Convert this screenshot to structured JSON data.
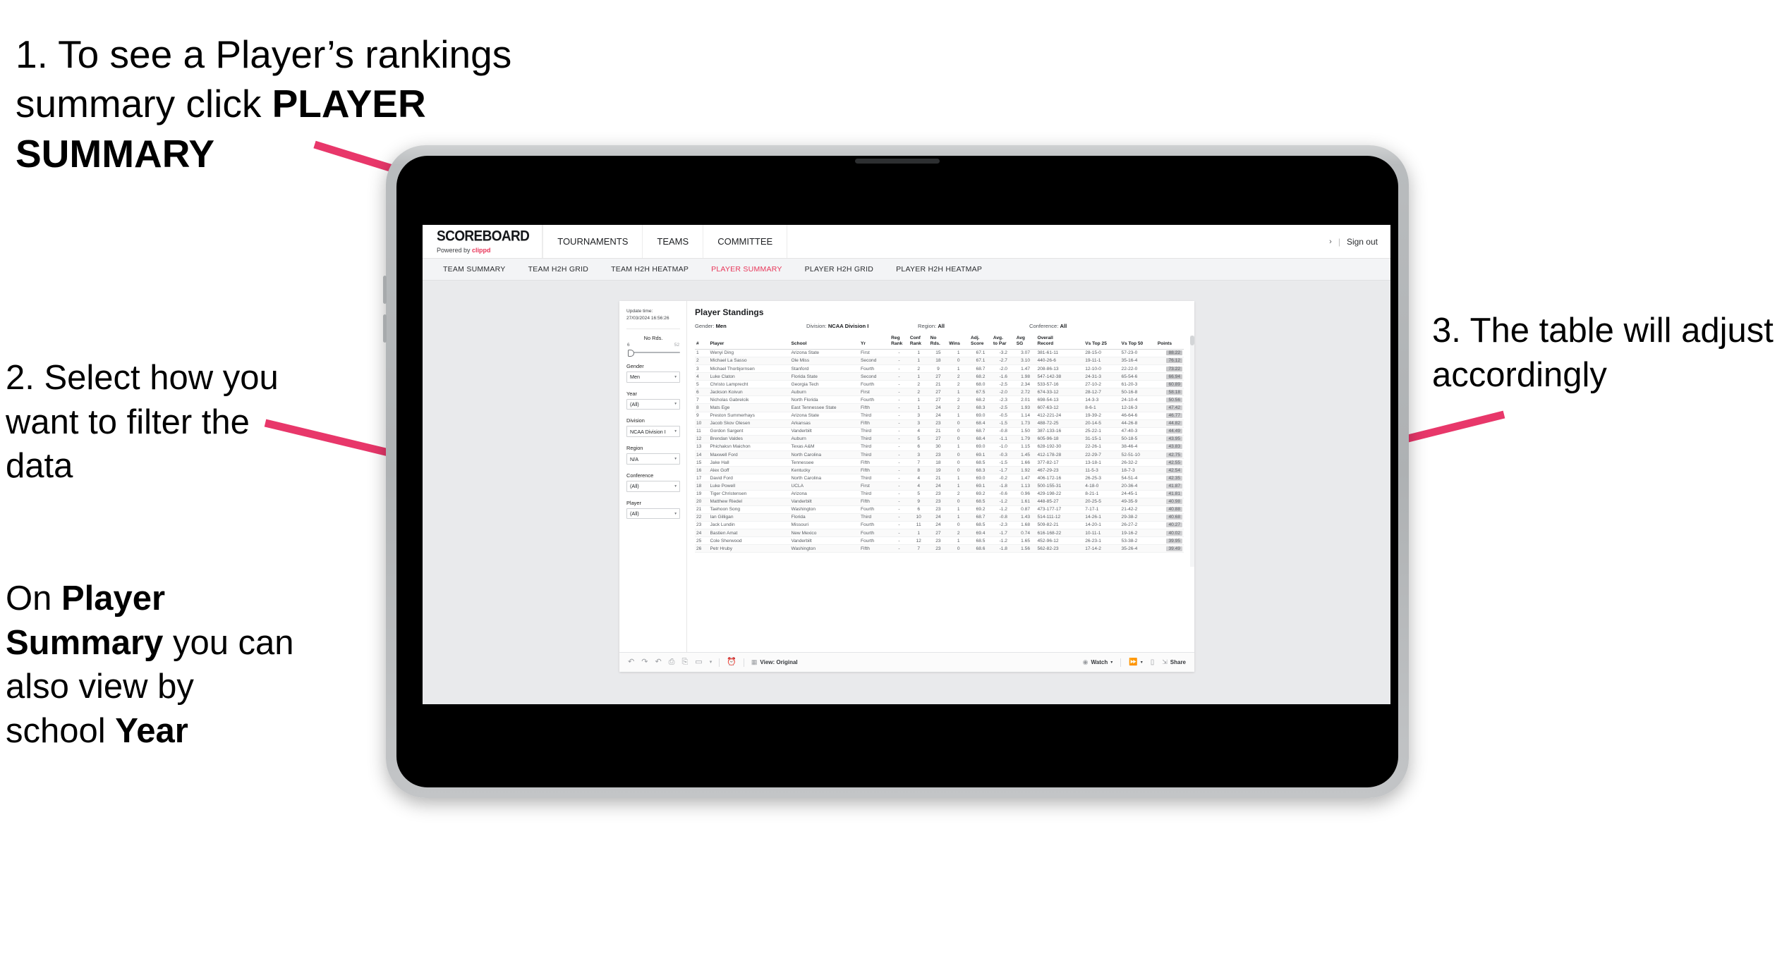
{
  "annotations": {
    "step1": {
      "number": "1.",
      "text_plain_a": "To see a Player’s rankings summary click ",
      "text_bold": "PLAYER SUMMARY"
    },
    "step2": {
      "text": "2. Select how you want to filter the data"
    },
    "step2b": {
      "prefix": "On ",
      "bold1": "Player Summary",
      "mid": " you can also view by school ",
      "bold2": "Year"
    },
    "step3": {
      "text": "3. The table will adjust accordingly"
    },
    "arrow_color": "#e8376a"
  },
  "header": {
    "brand_title": "SCOREBOARD",
    "brand_sub_prefix": "Powered by ",
    "brand_sub_name": "clippd",
    "nav": [
      {
        "label": "TOURNAMENTS"
      },
      {
        "label": "TEAMS"
      },
      {
        "label": "COMMITTEE"
      }
    ],
    "chevron": "›",
    "separator": "|",
    "sign_out": "Sign out"
  },
  "subnav": {
    "items": [
      {
        "label": "TEAM SUMMARY",
        "active": false
      },
      {
        "label": "TEAM H2H GRID",
        "active": false
      },
      {
        "label": "TEAM H2H HEATMAP",
        "active": false
      },
      {
        "label": "PLAYER SUMMARY",
        "active": true
      },
      {
        "label": "PLAYER H2H GRID",
        "active": false
      },
      {
        "label": "PLAYER H2H HEATMAP",
        "active": false
      }
    ],
    "active_color": "#e8375a"
  },
  "filters": {
    "update_label": "Update time:",
    "update_value": "27/03/2024 16:56:26",
    "slider": {
      "title": "No Rds.",
      "min": "6",
      "max": "52"
    },
    "selects": [
      {
        "label": "Gender",
        "value": "Men"
      },
      {
        "label": "Year",
        "value": "(All)"
      },
      {
        "label": "Division",
        "value": "NCAA Division I"
      },
      {
        "label": "Region",
        "value": "N/A"
      },
      {
        "label": "Conference",
        "value": "(All)"
      },
      {
        "label": "Player",
        "value": "(All)"
      }
    ],
    "caret": "▾"
  },
  "viz": {
    "title": "Player Standings",
    "filter_summary": [
      {
        "key": "Gender:",
        "value": "Men"
      },
      {
        "key": "Division:",
        "value": "NCAA Division I"
      },
      {
        "key": "Region:",
        "value": "All"
      },
      {
        "key": "Conference:",
        "value": "All"
      }
    ],
    "columns": [
      {
        "l1": "#",
        "l2": ""
      },
      {
        "l1": "Player",
        "l2": ""
      },
      {
        "l1": "School",
        "l2": ""
      },
      {
        "l1": "Yr",
        "l2": ""
      },
      {
        "l1": "Reg",
        "l2": "Rank"
      },
      {
        "l1": "Conf",
        "l2": "Rank"
      },
      {
        "l1": "No",
        "l2": "Rds."
      },
      {
        "l1": "Wins",
        "l2": ""
      },
      {
        "l1": "Adj.",
        "l2": "Score"
      },
      {
        "l1": "Avg.",
        "l2": "to Par"
      },
      {
        "l1": "Avg",
        "l2": "SG"
      },
      {
        "l1": "Overall",
        "l2": "Record"
      },
      {
        "l1": "Vs Top 25",
        "l2": ""
      },
      {
        "l1": "Vs Top 50",
        "l2": ""
      },
      {
        "l1": "Points",
        "l2": ""
      }
    ],
    "rows": [
      {
        "n": "1",
        "player": "Wenyi Ding",
        "school": "Arizona State",
        "yr": "First",
        "reg": "-",
        "conf": "1",
        "rds": "15",
        "wins": "1",
        "adj": "67.1",
        "par": "-3.2",
        "sg": "3.07",
        "rec": "381-61-11",
        "t25": "28-15-0",
        "t50": "57-23-0",
        "pts": "88.22"
      },
      {
        "n": "2",
        "player": "Michael La Sasso",
        "school": "Ole Miss",
        "yr": "Second",
        "reg": "-",
        "conf": "1",
        "rds": "18",
        "wins": "0",
        "adj": "67.1",
        "par": "-2.7",
        "sg": "3.10",
        "rec": "440-26-6",
        "t25": "19-11-1",
        "t50": "35-16-4",
        "pts": "76.12"
      },
      {
        "n": "3",
        "player": "Michael Thorbjornsen",
        "school": "Stanford",
        "yr": "Fourth",
        "reg": "-",
        "conf": "2",
        "rds": "9",
        "wins": "1",
        "adj": "68.7",
        "par": "-2.0",
        "sg": "1.47",
        "rec": "208-86-13",
        "t25": "12-10-0",
        "t50": "22-22-0",
        "pts": "73.22"
      },
      {
        "n": "4",
        "player": "Luke Claton",
        "school": "Florida State",
        "yr": "Second",
        "reg": "-",
        "conf": "1",
        "rds": "27",
        "wins": "2",
        "adj": "68.2",
        "par": "-1.6",
        "sg": "1.98",
        "rec": "547-142-38",
        "t25": "24-31-3",
        "t50": "65-54-6",
        "pts": "66.94"
      },
      {
        "n": "5",
        "player": "Christo Lamprecht",
        "school": "Georgia Tech",
        "yr": "Fourth",
        "reg": "-",
        "conf": "2",
        "rds": "21",
        "wins": "2",
        "adj": "68.0",
        "par": "-2.5",
        "sg": "2.34",
        "rec": "533-57-16",
        "t25": "27-10-2",
        "t50": "61-20-3",
        "pts": "60.89"
      },
      {
        "n": "6",
        "player": "Jackson Koivun",
        "school": "Auburn",
        "yr": "First",
        "reg": "-",
        "conf": "2",
        "rds": "27",
        "wins": "1",
        "adj": "67.5",
        "par": "-2.0",
        "sg": "2.72",
        "rec": "674-33-12",
        "t25": "28-12-7",
        "t50": "50-16-8",
        "pts": "58.18"
      },
      {
        "n": "7",
        "player": "Nicholas Gabrelcik",
        "school": "North Florida",
        "yr": "Fourth",
        "reg": "-",
        "conf": "1",
        "rds": "27",
        "wins": "2",
        "adj": "68.2",
        "par": "-2.3",
        "sg": "2.01",
        "rec": "698-54-13",
        "t25": "14-3-3",
        "t50": "24-10-4",
        "pts": "50.56"
      },
      {
        "n": "8",
        "player": "Mats Ege",
        "school": "East Tennessee State",
        "yr": "Fifth",
        "reg": "-",
        "conf": "1",
        "rds": "24",
        "wins": "2",
        "adj": "68.3",
        "par": "-2.5",
        "sg": "1.93",
        "rec": "607-63-12",
        "t25": "8-6-1",
        "t50": "12-16-3",
        "pts": "47.42"
      },
      {
        "n": "9",
        "player": "Preston Summerhays",
        "school": "Arizona State",
        "yr": "Third",
        "reg": "-",
        "conf": "3",
        "rds": "24",
        "wins": "1",
        "adj": "69.0",
        "par": "-0.5",
        "sg": "1.14",
        "rec": "412-221-24",
        "t25": "19-39-2",
        "t50": "46-64-6",
        "pts": "46.77"
      },
      {
        "n": "10",
        "player": "Jacob Skov Olesen",
        "school": "Arkansas",
        "yr": "Fifth",
        "reg": "-",
        "conf": "3",
        "rds": "23",
        "wins": "0",
        "adj": "68.4",
        "par": "-1.5",
        "sg": "1.73",
        "rec": "488-72-25",
        "t25": "20-14-5",
        "t50": "44-26-8",
        "pts": "44.82"
      },
      {
        "n": "11",
        "player": "Gordon Sargent",
        "school": "Vanderbilt",
        "yr": "Third",
        "reg": "-",
        "conf": "4",
        "rds": "21",
        "wins": "0",
        "adj": "68.7",
        "par": "-0.8",
        "sg": "1.50",
        "rec": "387-133-16",
        "t25": "25-22-1",
        "t50": "47-40-3",
        "pts": "44.49"
      },
      {
        "n": "12",
        "player": "Brendan Valdes",
        "school": "Auburn",
        "yr": "Third",
        "reg": "-",
        "conf": "5",
        "rds": "27",
        "wins": "0",
        "adj": "68.4",
        "par": "-1.1",
        "sg": "1.79",
        "rec": "605-96-18",
        "t25": "31-15-1",
        "t50": "50-18-5",
        "pts": "43.95"
      },
      {
        "n": "13",
        "player": "Phichaksn Maichon",
        "school": "Texas A&M",
        "yr": "Third",
        "reg": "-",
        "conf": "6",
        "rds": "30",
        "wins": "1",
        "adj": "69.0",
        "par": "-1.0",
        "sg": "1.15",
        "rec": "628-192-30",
        "t25": "22-26-1",
        "t50": "38-46-4",
        "pts": "43.83"
      },
      {
        "n": "14",
        "player": "Maxwell Ford",
        "school": "North Carolina",
        "yr": "Third",
        "reg": "-",
        "conf": "3",
        "rds": "23",
        "wins": "0",
        "adj": "69.1",
        "par": "-0.3",
        "sg": "1.45",
        "rec": "412-178-28",
        "t25": "22-29-7",
        "t50": "52-51-10",
        "pts": "42.75"
      },
      {
        "n": "15",
        "player": "Jake Hall",
        "school": "Tennessee",
        "yr": "Fifth",
        "reg": "-",
        "conf": "7",
        "rds": "18",
        "wins": "0",
        "adj": "68.5",
        "par": "-1.5",
        "sg": "1.66",
        "rec": "377-82-17",
        "t25": "13-18-1",
        "t50": "26-32-2",
        "pts": "42.55"
      },
      {
        "n": "16",
        "player": "Alex Goff",
        "school": "Kentucky",
        "yr": "Fifth",
        "reg": "-",
        "conf": "8",
        "rds": "19",
        "wins": "0",
        "adj": "68.3",
        "par": "-1.7",
        "sg": "1.92",
        "rec": "467-29-23",
        "t25": "11-5-3",
        "t50": "18-7-3",
        "pts": "42.54"
      },
      {
        "n": "17",
        "player": "David Ford",
        "school": "North Carolina",
        "yr": "Third",
        "reg": "-",
        "conf": "4",
        "rds": "21",
        "wins": "1",
        "adj": "69.0",
        "par": "-0.2",
        "sg": "1.47",
        "rec": "406-172-16",
        "t25": "26-25-3",
        "t50": "54-51-4",
        "pts": "42.35"
      },
      {
        "n": "18",
        "player": "Luke Powell",
        "school": "UCLA",
        "yr": "First",
        "reg": "-",
        "conf": "4",
        "rds": "24",
        "wins": "1",
        "adj": "69.1",
        "par": "-1.8",
        "sg": "1.13",
        "rec": "500-155-31",
        "t25": "4-18-0",
        "t50": "20-36-4",
        "pts": "41.87"
      },
      {
        "n": "19",
        "player": "Tiger Christensen",
        "school": "Arizona",
        "yr": "Third",
        "reg": "-",
        "conf": "5",
        "rds": "23",
        "wins": "2",
        "adj": "69.2",
        "par": "-0.6",
        "sg": "0.96",
        "rec": "429-198-22",
        "t25": "8-21-1",
        "t50": "24-45-1",
        "pts": "41.81"
      },
      {
        "n": "20",
        "player": "Matthew Riedel",
        "school": "Vanderbilt",
        "yr": "Fifth",
        "reg": "-",
        "conf": "9",
        "rds": "23",
        "wins": "0",
        "adj": "68.5",
        "par": "-1.2",
        "sg": "1.61",
        "rec": "448-85-27",
        "t25": "20-25-5",
        "t50": "49-35-9",
        "pts": "40.98"
      },
      {
        "n": "21",
        "player": "Taehoon Song",
        "school": "Washington",
        "yr": "Fourth",
        "reg": "-",
        "conf": "6",
        "rds": "23",
        "wins": "1",
        "adj": "69.2",
        "par": "-1.2",
        "sg": "0.87",
        "rec": "473-177-17",
        "t25": "7-17-1",
        "t50": "21-42-2",
        "pts": "40.88"
      },
      {
        "n": "22",
        "player": "Ian Gilligan",
        "school": "Florida",
        "yr": "Third",
        "reg": "-",
        "conf": "10",
        "rds": "24",
        "wins": "1",
        "adj": "68.7",
        "par": "-0.8",
        "sg": "1.43",
        "rec": "514-111-12",
        "t25": "14-26-1",
        "t50": "29-38-2",
        "pts": "40.68"
      },
      {
        "n": "23",
        "player": "Jack Lundin",
        "school": "Missouri",
        "yr": "Fourth",
        "reg": "-",
        "conf": "11",
        "rds": "24",
        "wins": "0",
        "adj": "68.5",
        "par": "-2.3",
        "sg": "1.68",
        "rec": "509-82-21",
        "t25": "14-20-1",
        "t50": "26-27-2",
        "pts": "40.27"
      },
      {
        "n": "24",
        "player": "Bastien Amat",
        "school": "New Mexico",
        "yr": "Fourth",
        "reg": "-",
        "conf": "1",
        "rds": "27",
        "wins": "2",
        "adj": "69.4",
        "par": "-1.7",
        "sg": "0.74",
        "rec": "616-168-22",
        "t25": "10-11-1",
        "t50": "19-16-2",
        "pts": "40.02"
      },
      {
        "n": "25",
        "player": "Cole Sherwood",
        "school": "Vanderbilt",
        "yr": "Fourth",
        "reg": "-",
        "conf": "12",
        "rds": "23",
        "wins": "1",
        "adj": "68.5",
        "par": "-1.2",
        "sg": "1.65",
        "rec": "452-96-12",
        "t25": "26-23-1",
        "t50": "53-38-2",
        "pts": "39.95"
      },
      {
        "n": "26",
        "player": "Petr Hruby",
        "school": "Washington",
        "yr": "Fifth",
        "reg": "-",
        "conf": "7",
        "rds": "23",
        "wins": "0",
        "adj": "68.6",
        "par": "-1.8",
        "sg": "1.56",
        "rec": "562-82-23",
        "t25": "17-14-2",
        "t50": "35-26-4",
        "pts": "39.49"
      }
    ]
  },
  "toolbar": {
    "icons": [
      "undo-icon",
      "redo-icon",
      "revert-icon",
      "refresh-icon",
      "pause-icon",
      "rectangle-select-icon"
    ],
    "view_label": "View: Original",
    "watch_label": "Watch",
    "share_label": "Share",
    "caret": "▾"
  }
}
